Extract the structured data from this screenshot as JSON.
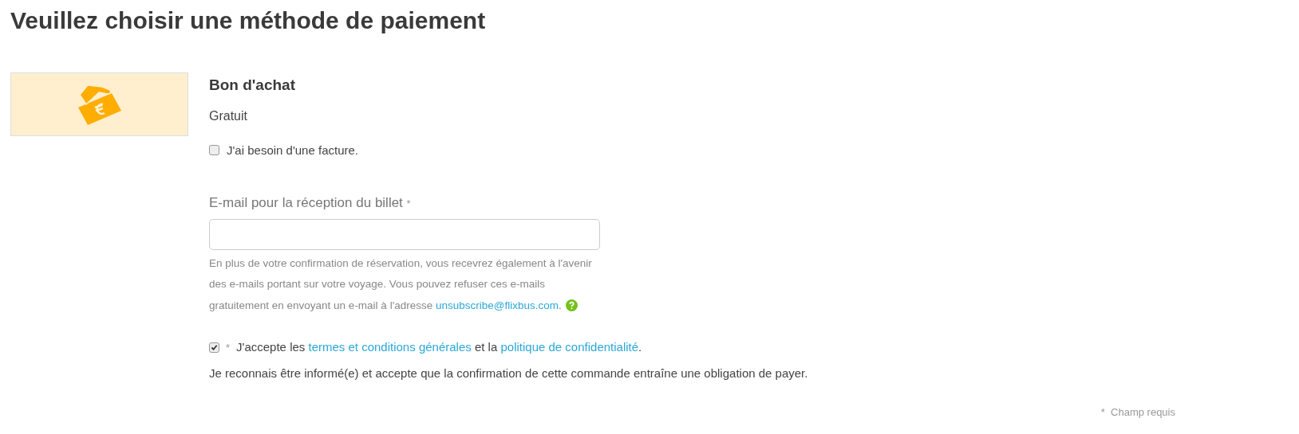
{
  "title": "Veuillez choisir une méthode de paiement",
  "method": {
    "kind": "picture",
    "name": "Bon d'achat",
    "price": "Gratuit"
  },
  "invoice": {
    "label": "J'ai besoin d'une facture.",
    "checked": false
  },
  "email": {
    "label": "E-mail pour la réception du billet",
    "required": "*",
    "help": [
      {
        "kind": "text",
        "text": "En plus de votre confirmation de réservation, vous recevrez également à l'avenir des e-mails portant sur votre voyage. Vous pouvez refuser ces e-mails gratuitement en envoyant un e-mail à l'adresse "
      },
      {
        "kind": "link",
        "text": "unsubscribe@flixbus.com"
      },
      {
        "kind": "text",
        "text": "."
      }
    ]
  },
  "terms": {
    "checked": true,
    "required": "*",
    "parts": [
      {
        "kind": "text",
        "text": "J'accepte les "
      },
      {
        "kind": "link",
        "text": "termes et conditions générales"
      },
      {
        "kind": "text",
        "text": " et la "
      },
      {
        "kind": "link",
        "text": "politique de confidentialité"
      },
      {
        "kind": "text",
        "text": "."
      }
    ],
    "notice": "Je reconnais être informé(e) et accepte que la confirmation de cette commande entraîne une obligation de payer."
  },
  "required_note": "*  Champ requis"
}
